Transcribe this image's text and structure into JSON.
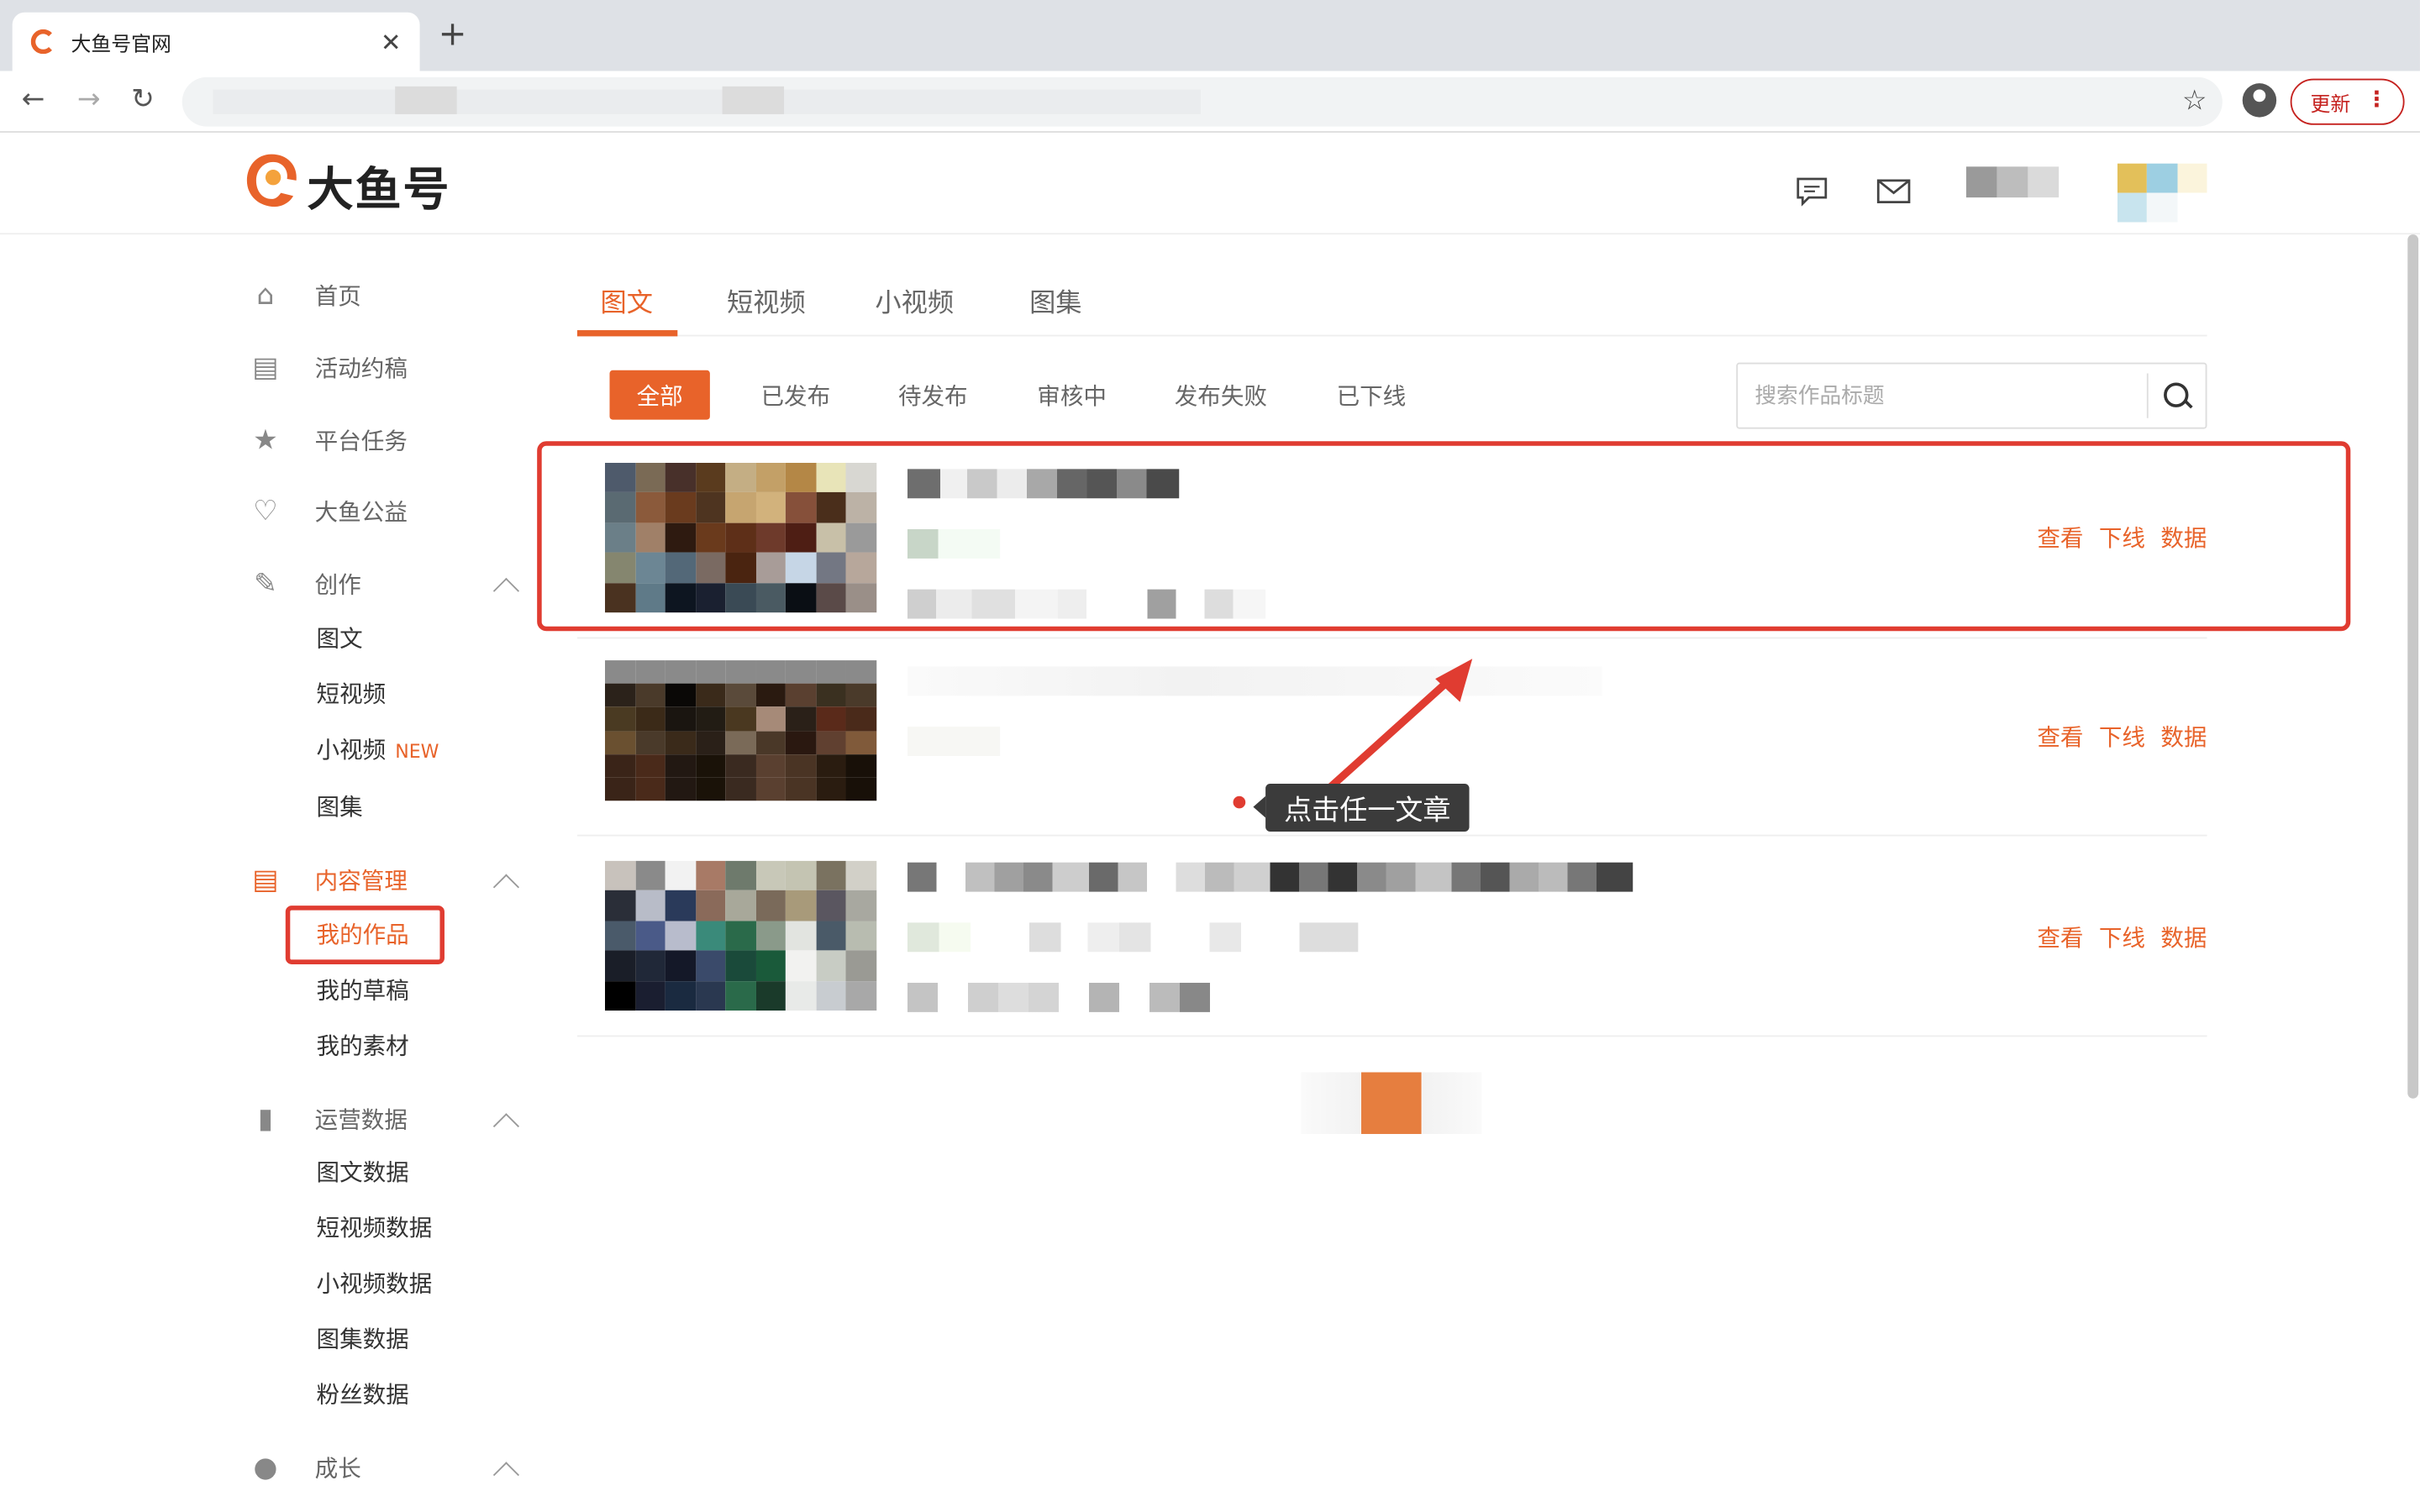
{
  "browser": {
    "tab_title": "大鱼号官网",
    "tab_close": "✕",
    "new_tab": "+",
    "back": "←",
    "forward": "→",
    "reload": "↻",
    "bookmark": "☆",
    "update_label": "更新",
    "menu_dots": "⋮"
  },
  "site": {
    "logo_text": "大鱼号",
    "header_icons": [
      "comment-icon",
      "mail-icon"
    ]
  },
  "sidebar": {
    "items": [
      {
        "label": "首页",
        "icon": "⌂"
      },
      {
        "label": "活动约稿",
        "icon": "▤"
      },
      {
        "label": "平台任务",
        "icon": "★"
      },
      {
        "label": "大鱼公益",
        "icon": "♡"
      }
    ],
    "create": {
      "label": "创作",
      "icon": "✎",
      "children": [
        "图文",
        "短视频",
        "小视频",
        "图集"
      ],
      "new_badge": "NEW"
    },
    "content": {
      "label": "内容管理",
      "icon": "▤",
      "children": [
        "我的作品",
        "我的草稿",
        "我的素材"
      ]
    },
    "ops": {
      "label": "运营数据",
      "icon": "▮",
      "children": [
        "图文数据",
        "短视频数据",
        "小视频数据",
        "图集数据",
        "粉丝数据"
      ]
    },
    "growth": {
      "label": "成长",
      "icon": "●"
    }
  },
  "content_tabs": [
    "图文",
    "短视频",
    "小视频",
    "图集"
  ],
  "filters": [
    "全部",
    "已发布",
    "待发布",
    "审核中",
    "发布失败",
    "已下线"
  ],
  "search": {
    "placeholder": "搜索作品标题"
  },
  "row_actions": {
    "view": "查看",
    "offline": "下线",
    "data": "数据"
  },
  "annotation": {
    "tooltip": "点击任一文章"
  },
  "colors": {
    "accent": "#e8632a",
    "highlight": "#e03c31"
  }
}
